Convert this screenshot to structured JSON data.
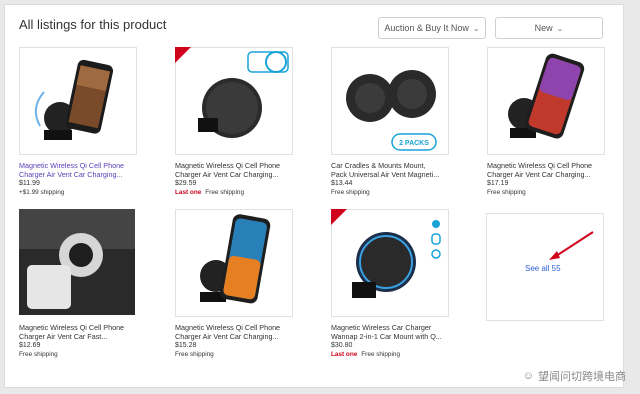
{
  "header": {
    "title": "All listings for this product",
    "filter_label": "Auction & Buy It Now",
    "condition_label": "New"
  },
  "listings": [
    {
      "title": "Magnetic Wireless Qi Cell Phone Charger Air Vent Car Charging...",
      "price": "$11.99",
      "shipping": "+$1.99 shipping",
      "last_one": ""
    },
    {
      "title": "Magnetic Wireless Qi Cell Phone Charger Air Vent Car Charging...",
      "price": "$29.59",
      "shipping": "Free shipping",
      "last_one": "Last one"
    },
    {
      "title": "Car Cradles & Mounts Mount, Pack Universal Air Vent Magneti...",
      "price": "$13.44",
      "shipping": "Free shipping",
      "last_one": "",
      "tag": "2 PACKS"
    },
    {
      "title": "Magnetic Wireless Qi Cell Phone Charger Air Vent Car Charging...",
      "price": "$17.19",
      "shipping": "Free shipping",
      "last_one": ""
    },
    {
      "title": "Magnetic Wireless Qi Cell Phone Charger Air Vent Car Fast...",
      "price": "$12.69",
      "shipping": "Free shipping",
      "last_one": ""
    },
    {
      "title": "Magnetic Wireless Qi Cell Phone Charger Air Vent Car Charging...",
      "price": "$15.28",
      "shipping": "Free shipping",
      "last_one": ""
    },
    {
      "title": "Magnetic Wireless Car Charger Wannap 2-in-1 Car Mount with Q...",
      "price": "$30.80",
      "shipping": "Free shipping",
      "last_one": "Last one"
    }
  ],
  "see_all": "See all 55",
  "watermark": "望闻问切跨境电商"
}
